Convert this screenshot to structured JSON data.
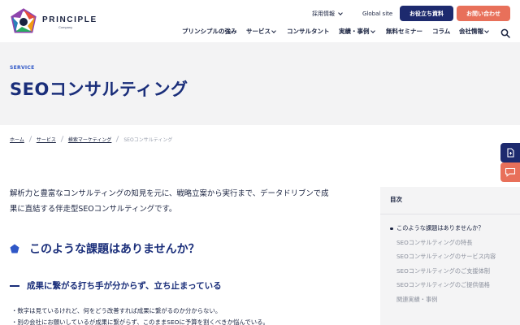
{
  "header": {
    "brand": "PRINCIPLE",
    "brand_sub": "Company",
    "recruit_label": "採用情報",
    "global_label": "Global site",
    "download_label": "お役立ち資料",
    "contact_label": "お問い合わせ",
    "nav": [
      {
        "label": "プリンシプルの強み",
        "has_menu": false
      },
      {
        "label": "サービス",
        "has_menu": true
      },
      {
        "label": "コンサルタント",
        "has_menu": false
      },
      {
        "label": "実績・事例",
        "has_menu": true
      },
      {
        "label": "無料セミナー",
        "has_menu": false
      },
      {
        "label": "コラム",
        "has_menu": false
      },
      {
        "label": "会社情報",
        "has_menu": true
      }
    ],
    "search_icon": "search-icon"
  },
  "hero": {
    "kicker": "SERVICE",
    "title": "SEOコンサルティング"
  },
  "breadcrumb": {
    "items": [
      "ホーム",
      "サービス",
      "検索マーケティング"
    ],
    "current": "SEOコンサルティング"
  },
  "main": {
    "lead_line1": "解析力と豊富なコンサルティングの知見を元に、戦略立案から実行まで、データドリブンで成",
    "lead_line2": "果に直結する伴走型SEOコンサルティングです。",
    "h2": "このような課題はありませんか？",
    "h3": "成果に繋がる打ち手が分からず、立ち止まっている",
    "bullets": [
      "・数字は見ているけれど、何をどう改善すれば成果に繋がるのか分からない。",
      "・別の会社にお願いしているが成果に繋がらず、このままSEOに予算を割くべきか悩んでいる。"
    ]
  },
  "toc": {
    "title": "目次",
    "items": [
      "このような課題はありませんか？",
      "SEOコンサルティングの特長",
      "SEOコンサルティングのサービス内容",
      "SEOコンサルティングのご支援体制",
      "SEOコンサルティングのご提供価格",
      "関連実績・事例"
    ]
  },
  "side_buttons": {
    "doc_icon": "document-icon",
    "chat_icon": "chat-icon"
  },
  "colors": {
    "navy": "#1d2a6e",
    "title_blue": "#1a2e7a",
    "accent_blue": "#2f57c7",
    "orange": "#e8705a",
    "hero_bg": "#f3f3f4"
  }
}
